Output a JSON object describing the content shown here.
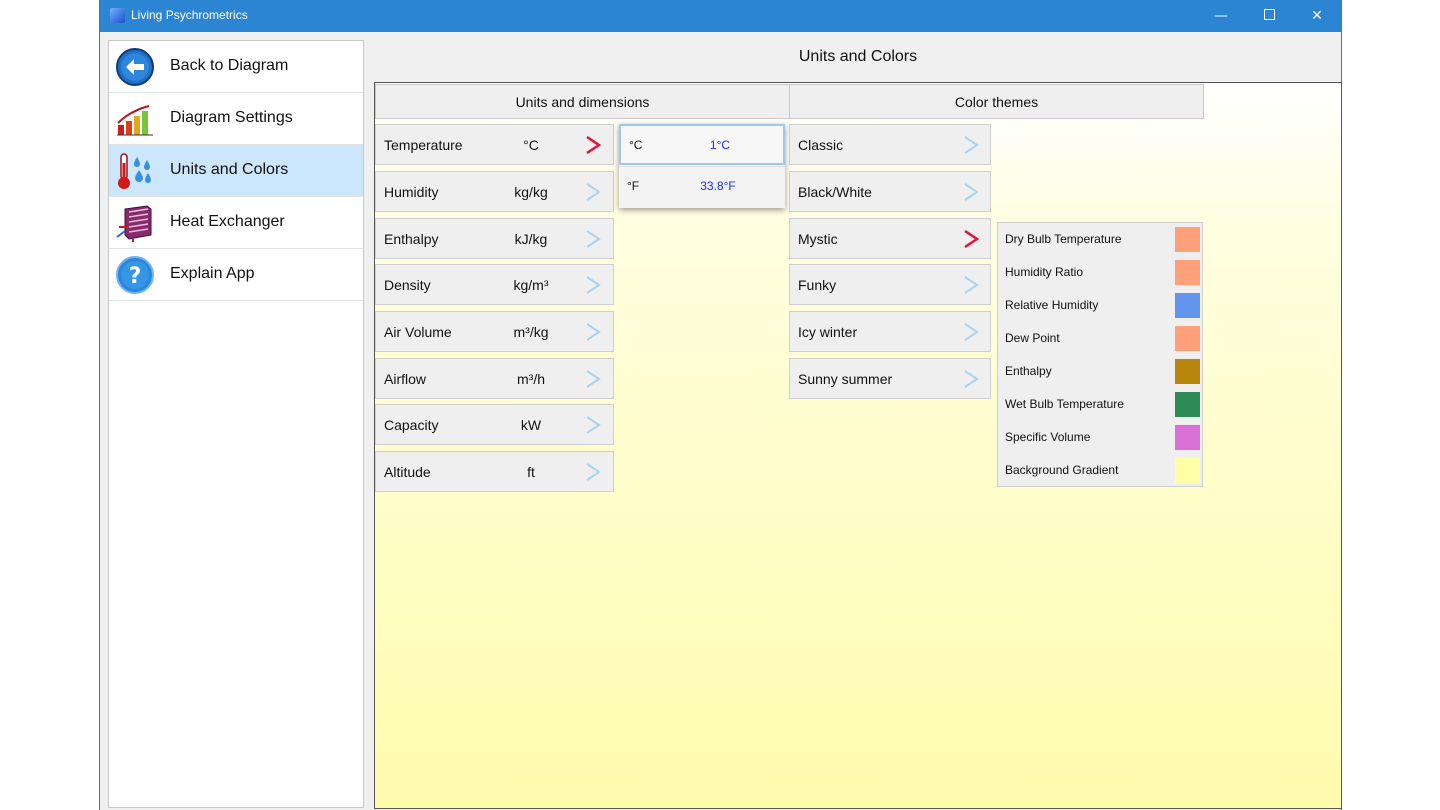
{
  "window": {
    "title": "Living Psychrometrics",
    "controls": {
      "minimize": "—",
      "close": "✕"
    }
  },
  "sidebar": {
    "items": [
      {
        "label": "Back to Diagram",
        "icon": "back-arrow-icon",
        "active": false
      },
      {
        "label": "Diagram Settings",
        "icon": "bar-chart-icon",
        "active": false
      },
      {
        "label": "Units and Colors",
        "icon": "thermometer-drops-icon",
        "active": true
      },
      {
        "label": "Heat Exchanger",
        "icon": "heat-exchanger-icon",
        "active": false
      },
      {
        "label": "Explain App",
        "icon": "help-icon",
        "active": false
      }
    ]
  },
  "header": {
    "title": "Units and Colors"
  },
  "units": {
    "heading": "Units and dimensions",
    "rows": [
      {
        "label": "Temperature",
        "unit": "°C",
        "selected": true
      },
      {
        "label": "Humidity",
        "unit": "kg/kg",
        "selected": false
      },
      {
        "label": "Enthalpy",
        "unit": "kJ/kg",
        "selected": false
      },
      {
        "label": "Density",
        "unit": "kg/m³",
        "selected": false
      },
      {
        "label": "Air Volume",
        "unit": "m³/kg",
        "selected": false
      },
      {
        "label": "Airflow",
        "unit": "m³/h",
        "selected": false
      },
      {
        "label": "Capacity",
        "unit": "kW",
        "selected": false
      },
      {
        "label": "Altitude",
        "unit": "ft",
        "selected": false
      }
    ]
  },
  "temperature_popup": {
    "options": [
      {
        "key": "°C",
        "value": "1°C",
        "selected": true
      },
      {
        "key": "°F",
        "value": "33.8°F",
        "selected": false
      }
    ]
  },
  "themes": {
    "heading": "Color themes",
    "rows": [
      {
        "label": "Classic",
        "selected": false
      },
      {
        "label": "Black/White",
        "selected": false
      },
      {
        "label": "Mystic",
        "selected": true
      },
      {
        "label": "Funky",
        "selected": false
      },
      {
        "label": "Icy winter",
        "selected": false
      },
      {
        "label": "Sunny summer",
        "selected": false
      }
    ]
  },
  "legend": {
    "items": [
      {
        "label": "Dry Bulb Temperature",
        "color": "#FFA07A"
      },
      {
        "label": "Humidity Ratio",
        "color": "#FFA07A"
      },
      {
        "label": "Relative Humidity",
        "color": "#6495ED"
      },
      {
        "label": "Dew Point",
        "color": "#FFA07A"
      },
      {
        "label": "Enthalpy",
        "color": "#B8860B"
      },
      {
        "label": "Wet Bulb Temperature",
        "color": "#2E8B57"
      },
      {
        "label": "Specific Volume",
        "color": "#DA70D6"
      },
      {
        "label": "Background Gradient",
        "color": "#FFFFA8"
      }
    ]
  },
  "colors": {
    "titlebar": "#2B85D3",
    "chevron_selected": "#E8103A",
    "chevron_default": "#A8D4F0",
    "popup_value": "#1A2DE8"
  }
}
